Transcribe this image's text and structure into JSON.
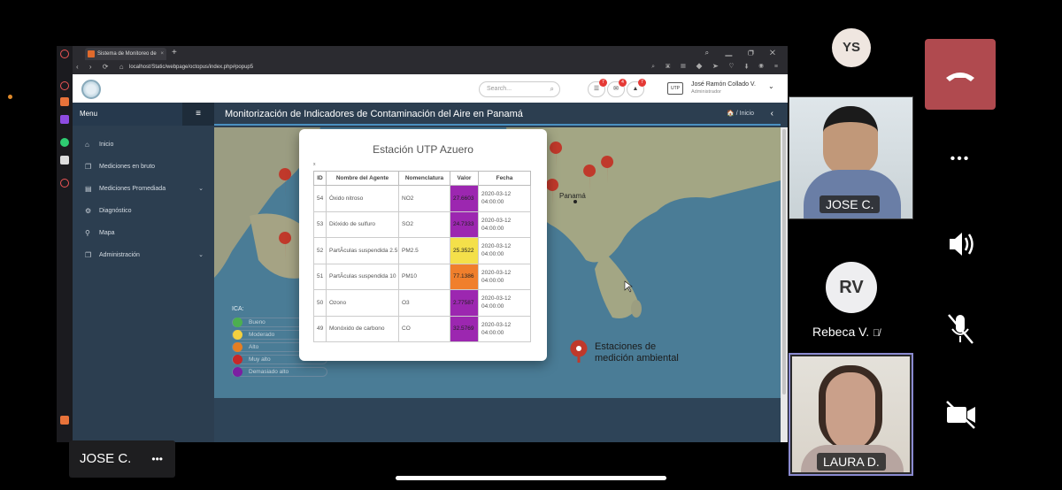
{
  "browser": {
    "tab_title": "Sistema de Monitoreo de",
    "url": "localhost/Static/webpage/octopus/index.php#popup5",
    "new_tab": "+"
  },
  "app": {
    "search_placeholder": "Search...",
    "badges": {
      "messages": "7",
      "mail": "4",
      "alerts": "7"
    },
    "user_name": "José Ramón Collado V.",
    "user_role": "Administrador",
    "user_logo": "UTP"
  },
  "sidebar": {
    "menu_label": "Menu",
    "items": [
      {
        "label": "Inicio",
        "icon": "home-icon"
      },
      {
        "label": "Mediciones en bruto",
        "icon": "copy-icon"
      },
      {
        "label": "Mediciones Promediada",
        "icon": "file-icon",
        "caret": "⌄"
      },
      {
        "label": "Diagnóstico",
        "icon": "gear-icon"
      },
      {
        "label": "Mapa",
        "icon": "pin-icon"
      },
      {
        "label": "Administración",
        "icon": "copy-icon",
        "caret": "⌄"
      }
    ]
  },
  "content": {
    "title": "Monitorización de Indicadores de Contaminación del Aire en Panamá",
    "breadcrumb": "Inicio"
  },
  "map": {
    "city_label": "Panamá",
    "legend_title": "ICA:",
    "legend": [
      {
        "label": "Bueno",
        "color": "#4caf50"
      },
      {
        "label": "Moderado",
        "color": "#f4d03f"
      },
      {
        "label": "Alto",
        "color": "#e67e22"
      },
      {
        "label": "Muy alto",
        "color": "#c62828"
      },
      {
        "label": "Demasiado alto",
        "color": "#7b1fa2"
      }
    ],
    "stations_line1": "Estaciones de",
    "stations_line2": "medición ambiental"
  },
  "popup": {
    "title": "Estación UTP Azuero",
    "close": "x",
    "columns": [
      "ID",
      "Nombre del Agente",
      "Nomenclatura",
      "Valor",
      "Fecha"
    ],
    "rows": [
      {
        "id": "54",
        "name": "Óxido nitroso",
        "code": "NO2",
        "value": "27.6603",
        "color": "#9c27b0",
        "date": "2020-03-12 04:00:00"
      },
      {
        "id": "53",
        "name": "Dióxido de sulfuro",
        "code": "SO2",
        "value": "24.7333",
        "color": "#9c27b0",
        "date": "2020-03-12 04:00:00"
      },
      {
        "id": "52",
        "name": "PartÃculas suspendida 2.5",
        "code": "PM2.5",
        "value": "25.3522",
        "color": "#f4e04a",
        "date": "2020-03-12 04:00:00"
      },
      {
        "id": "51",
        "name": "PartÃculas suspendida 10",
        "code": "PM10",
        "value": "77.1386",
        "color": "#f07f2c",
        "date": "2020-03-12 04:00:00"
      },
      {
        "id": "50",
        "name": "Ozono",
        "code": "O3",
        "value": "2.77587",
        "color": "#9c27b0",
        "date": "2020-03-12 04:00:00"
      },
      {
        "id": "49",
        "name": "Monóxido de carbono",
        "code": "CO",
        "value": "32.5769",
        "color": "#9c27b0",
        "date": "2020-03-12 04:00:00"
      }
    ]
  },
  "meeting": {
    "participants": [
      {
        "initials": "YS"
      },
      {
        "name": "JOSE C."
      },
      {
        "initials": "RV",
        "name": "Rebeca V."
      },
      {
        "name": "LAURA D."
      }
    ],
    "speaker_tag": "JOSE C.",
    "more": "•••",
    "end_call_color": "#b04a4f"
  }
}
